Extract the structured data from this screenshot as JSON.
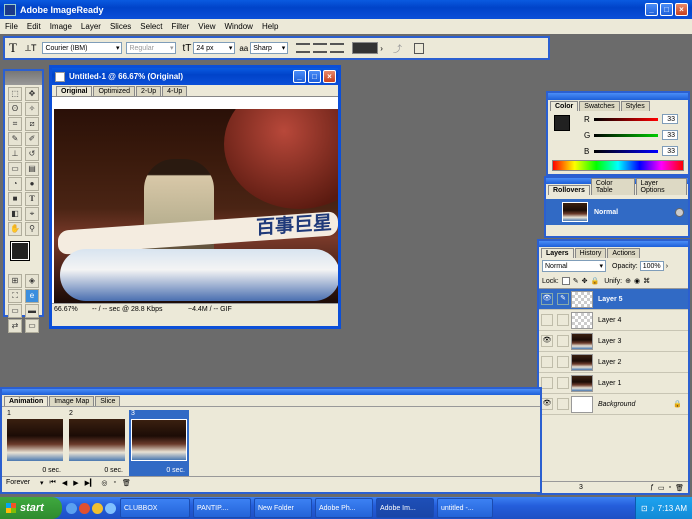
{
  "app": {
    "title": "Adobe ImageReady",
    "menu": [
      "File",
      "Edit",
      "Image",
      "Layer",
      "Slices",
      "Select",
      "Filter",
      "View",
      "Window",
      "Help"
    ]
  },
  "options_bar": {
    "font_family": "Courier (IBM)",
    "font_style": "Regular",
    "font_size": "24 px",
    "antialias": "Sharp"
  },
  "document": {
    "title": "Untitled-1 @ 66.67% (Original)",
    "tabs": [
      "Original",
      "Optimized",
      "2-Up",
      "4-Up"
    ],
    "zoom": "66.67%",
    "download": "-- / -- sec @ 28.8 Kbps",
    "file_info": "~4.4M / -- GIF",
    "banner_text": "百事巨星"
  },
  "color_panel": {
    "tabs": [
      "Color",
      "Swatches",
      "Styles"
    ],
    "channels": [
      {
        "label": "R",
        "value": "33"
      },
      {
        "label": "G",
        "value": "33"
      },
      {
        "label": "B",
        "value": "33"
      }
    ]
  },
  "rollovers_panel": {
    "tabs": [
      "Rollovers",
      "Color Table",
      "Layer Options"
    ],
    "state": "Normal"
  },
  "layers_panel": {
    "tabs": [
      "Layers",
      "History",
      "Actions"
    ],
    "blend_mode": "Normal",
    "opacity_label": "Opacity:",
    "opacity": "100%",
    "lock_label": "Lock:",
    "unify_label": "Unify:",
    "layers": [
      {
        "name": "Layer 5",
        "visible": true,
        "selected": true,
        "type": "transparent"
      },
      {
        "name": "Layer 4",
        "visible": false,
        "selected": false,
        "type": "transparent"
      },
      {
        "name": "Layer 3",
        "visible": true,
        "selected": false,
        "type": "photo"
      },
      {
        "name": "Layer 2",
        "visible": false,
        "selected": false,
        "type": "photo"
      },
      {
        "name": "Layer 1",
        "visible": false,
        "selected": false,
        "type": "photo"
      },
      {
        "name": "Background",
        "visible": true,
        "selected": false,
        "type": "white"
      }
    ],
    "footer_count": "3"
  },
  "animation_panel": {
    "tabs": [
      "Animation",
      "Image Map",
      "Slice"
    ],
    "frames": [
      {
        "number": "1",
        "delay": "0 sec.",
        "selected": false
      },
      {
        "number": "2",
        "delay": "0 sec.",
        "selected": false
      },
      {
        "number": "3",
        "delay": "0 sec.",
        "selected": true
      }
    ],
    "loop": "Forever"
  },
  "taskbar": {
    "start": "start",
    "items": [
      "CLUBBOX",
      "PANTIP....",
      "New Folder",
      "Adobe Ph...",
      "Adobe Im...",
      "untitled -..."
    ],
    "clock": "7:13 AM"
  },
  "colors": {
    "xp_blue": "#0043c9",
    "panel_bg": "#ece9d8",
    "workspace": "#6b6b6b",
    "selected_layer": "#316ac5",
    "foreground": "#212121",
    "background": "#ffffff"
  }
}
